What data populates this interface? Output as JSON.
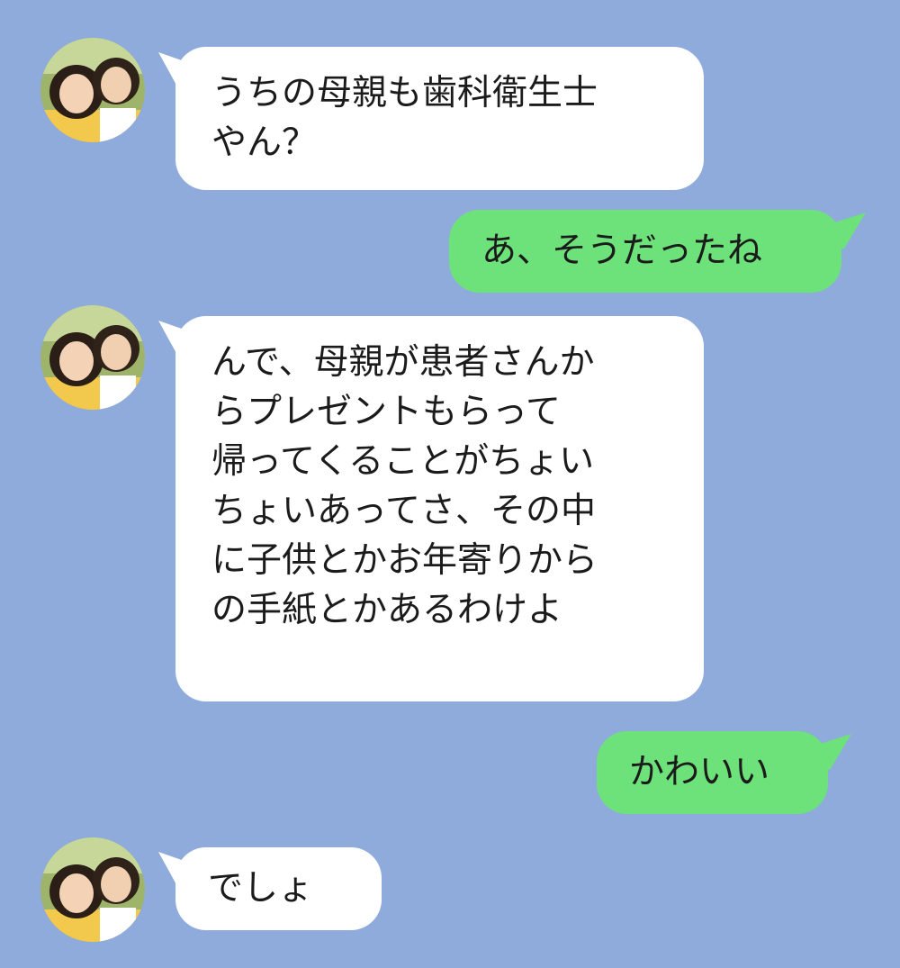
{
  "chat": {
    "messages": [
      {
        "sender": "friend",
        "text": "うちの母親も歯科衛生士\nやん？"
      },
      {
        "sender": "me",
        "text": "あ、そうだったね"
      },
      {
        "sender": "friend",
        "text": "んで、母親が患者さんか\nらプレゼントもらって\n帰ってくることがちょい\nちょいあってさ、その中\nに子供とかお年寄りから\nの手紙とかあるわけよ"
      },
      {
        "sender": "me",
        "text": "かわいい"
      },
      {
        "sender": "friend",
        "text": "でしょ"
      }
    ]
  },
  "colors": {
    "background": "#8eabdb",
    "incoming_bubble": "#ffffff",
    "outgoing_bubble": "#6ee27a",
    "text": "#1b1b1b"
  },
  "icons": {
    "friend_avatar": "avatar-photo-two-women",
    "incoming_tail": "speech-tail-left",
    "outgoing_tail": "speech-tail-right"
  }
}
